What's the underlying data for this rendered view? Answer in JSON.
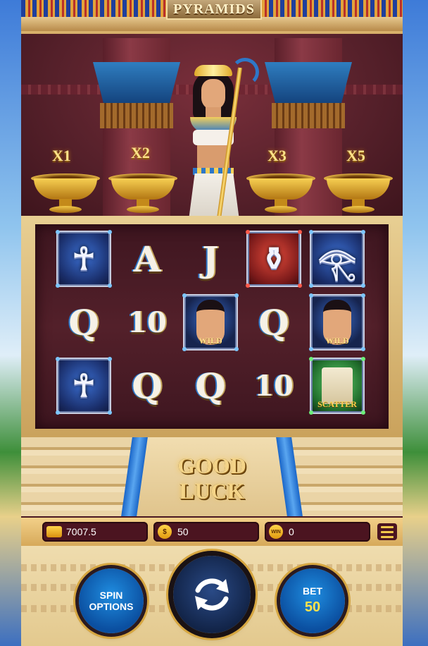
{
  "game": {
    "title": "PYRAMIDS"
  },
  "multipliers": [
    "X1",
    "X2",
    "X3",
    "X5"
  ],
  "reels": [
    [
      {
        "type": "ankh-tile",
        "glyph": "☥",
        "style": ""
      },
      {
        "type": "letter",
        "glyph": "Q"
      },
      {
        "type": "ankh-tile",
        "glyph": "☥",
        "style": ""
      }
    ],
    [
      {
        "type": "letter",
        "glyph": "A"
      },
      {
        "type": "letter",
        "glyph": "10"
      },
      {
        "type": "letter",
        "glyph": "Q"
      }
    ],
    [
      {
        "type": "letter",
        "glyph": "J"
      },
      {
        "type": "wild-tile",
        "label": "WILD"
      },
      {
        "type": "letter",
        "glyph": "Q"
      }
    ],
    [
      {
        "type": "potion-tile",
        "glyph": "⚱",
        "style": "red"
      },
      {
        "type": "letter",
        "glyph": "Q"
      },
      {
        "type": "letter",
        "glyph": "10"
      }
    ],
    [
      {
        "type": "eye-tile",
        "glyph": "𓂀",
        "style": ""
      },
      {
        "type": "wild-tile",
        "label": "WILD"
      },
      {
        "type": "scatter-tile",
        "label": "SCATTER"
      }
    ]
  ],
  "message": {
    "line1": "GOOD",
    "line2": "LUCK"
  },
  "status": {
    "balance": "7007.5",
    "bet_icon": "$",
    "bet": "50",
    "win_icon": "WIN",
    "win": "0"
  },
  "controls": {
    "spin_options_line1": "SPIN",
    "spin_options_line2": "OPTIONS",
    "bet_label": "BET",
    "bet_value": "50"
  },
  "icons": {
    "wallet": "wallet-icon",
    "coin": "coin-icon",
    "win": "win-coin-icon",
    "menu": "menu-icon",
    "spin": "refresh-icon"
  },
  "colors": {
    "accent": "#d6a640",
    "button_blue": "#0b4fa0",
    "panel": "#4b1420"
  }
}
